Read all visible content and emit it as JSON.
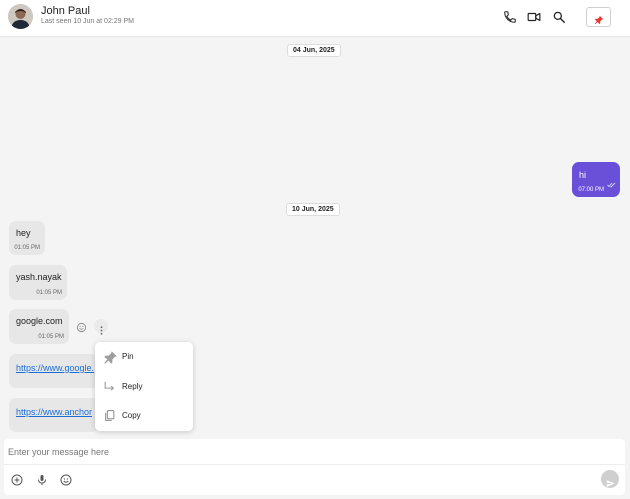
{
  "header": {
    "contact_name": "John Paul",
    "last_seen": "Last seen 10 Jun at 02:29 PM",
    "icons": [
      "phone-icon",
      "video-icon",
      "search-icon",
      "pin-icon"
    ]
  },
  "dates": [
    "04 Jun, 2025",
    "10 Jun, 2025"
  ],
  "messages": [
    {
      "direction": "out",
      "text": "hi",
      "time": "07:00 PM",
      "status": "read"
    },
    {
      "direction": "in",
      "text": "hey",
      "time": "01:05 PM"
    },
    {
      "direction": "in",
      "text": "yash.nayak",
      "time": "01:05 PM"
    },
    {
      "direction": "in",
      "text": "google.com",
      "time": "01:05 PM"
    },
    {
      "direction": "in",
      "text": "https://www.google.",
      "time": "",
      "is_link": true
    },
    {
      "direction": "in",
      "text": "https://www.anchor",
      "time": "",
      "is_link": true
    }
  ],
  "context_menu": {
    "items": [
      {
        "label": "Pin",
        "icon": "pin-icon"
      },
      {
        "label": "Reply",
        "icon": "reply-icon"
      },
      {
        "label": "Copy",
        "icon": "copy-icon"
      }
    ]
  },
  "composer": {
    "placeholder": "Enter your message here",
    "icons": [
      "add-icon",
      "mic-icon",
      "emoji-icon",
      "send-icon"
    ]
  },
  "colors": {
    "accent": "#6a4fd8",
    "incoming_bubble": "#e7e7e7",
    "background": "#f4f4f4",
    "link": "#1a6ed8",
    "pin_red": "#e53935"
  }
}
